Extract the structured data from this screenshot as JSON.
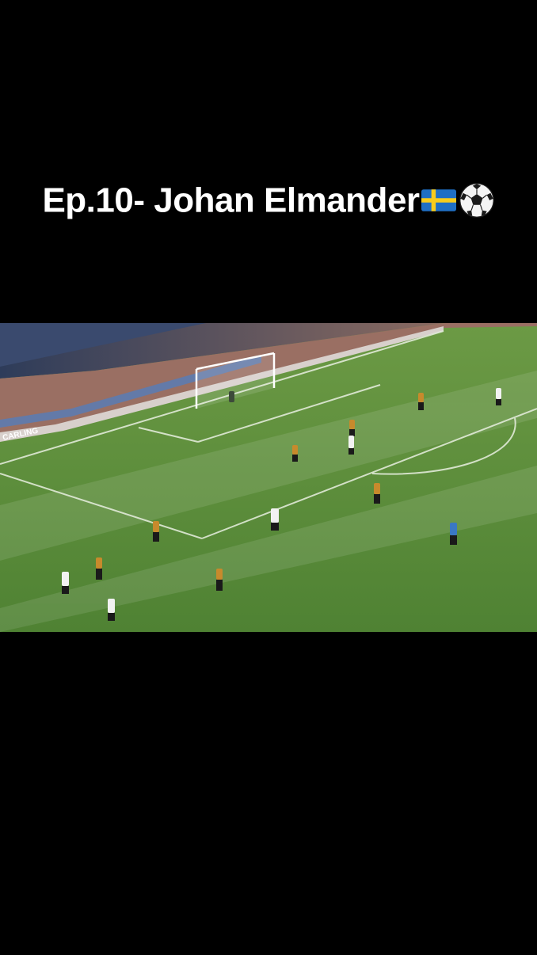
{
  "caption": {
    "title": "Ep.10- Johan Elmander",
    "flag_icon": "sweden-flag-icon",
    "ball_icon": "soccer-ball-icon"
  },
  "video": {
    "content": "football match footage",
    "pitch_color": "#5e8f3d",
    "stand_color": "#9a6f63",
    "ad_board_text": "CARLING"
  }
}
